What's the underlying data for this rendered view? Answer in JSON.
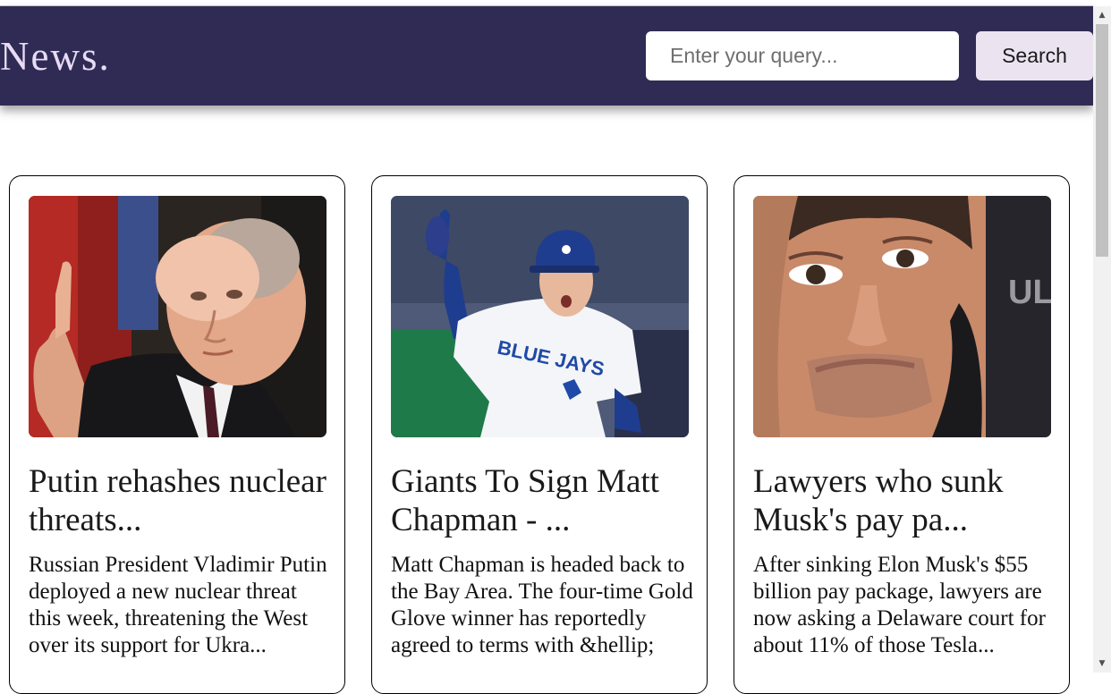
{
  "header": {
    "brand": "News.",
    "search_placeholder": "Enter your query...",
    "search_button": "Search",
    "background_color": "#302b55",
    "brand_color": "#e7dcf3"
  },
  "articles": [
    {
      "title": "Putin rehashes nuclear threats...",
      "description": "Russian President Vladimir Putin deployed a new nuclear threat this week, threatening the West over its support for Ukra..."
    },
    {
      "title": "Giants To Sign Matt Chapman - ...",
      "description": "Matt Chapman is headed back to the Bay Area. The four-time Gold Glove winner has reportedly agreed to terms with &hellip;"
    },
    {
      "title": "Lawyers who sunk Musk's pay pa...",
      "description": "After sinking Elon Musk's $55 billion pay package, lawyers are now asking a Delaware court for about 11% of those Tesla..."
    }
  ],
  "images": {
    "jersey_text": "BLUE JAYS",
    "backdrop_text": "ULT EVE"
  },
  "scrollbar": {
    "up_arrow": "▲",
    "down_arrow": "▼"
  }
}
